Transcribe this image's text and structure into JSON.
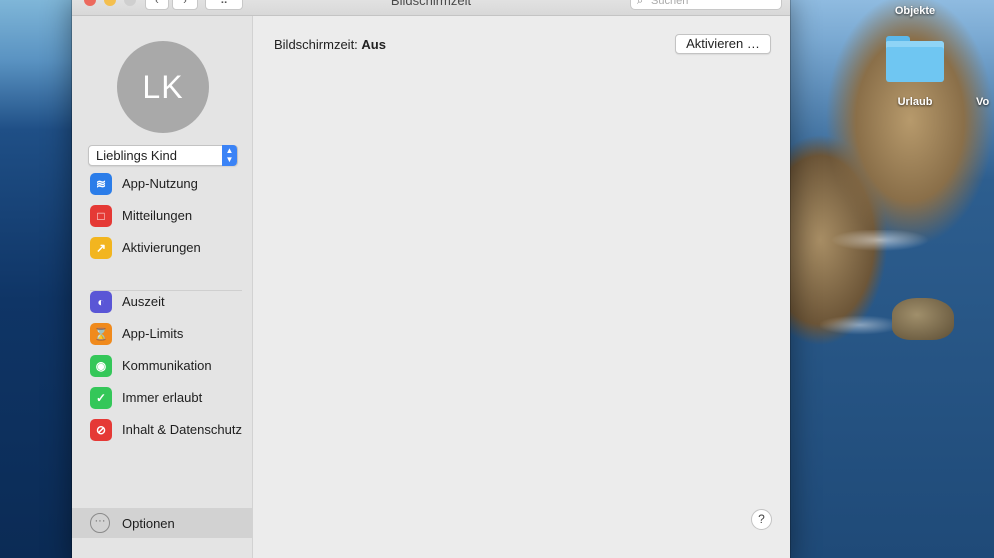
{
  "window": {
    "title": "Bildschirmzeit",
    "nav_back": "‹",
    "nav_forward": "›",
    "grid_button": "⠿",
    "search_placeholder": "Suchen"
  },
  "user": {
    "initials": "LK",
    "name": "Lieblings Kind"
  },
  "sidebar": {
    "items": [
      {
        "label": "App-Nutzung",
        "icon": "layers-icon",
        "color": "#2b7de9",
        "glyph": "≋"
      },
      {
        "label": "Mitteilungen",
        "icon": "notification-icon",
        "color": "#e53935",
        "glyph": "□"
      },
      {
        "label": "Aktivierungen",
        "icon": "pickups-icon",
        "color": "#f2b51f",
        "glyph": "↗"
      },
      {
        "label": "Auszeit",
        "icon": "downtime-icon",
        "color": "#5a56d6",
        "glyph": "◐"
      },
      {
        "label": "App-Limits",
        "icon": "hourglass-icon",
        "color": "#f08a1c",
        "glyph": "⌛"
      },
      {
        "label": "Kommunikation",
        "icon": "contact-icon",
        "color": "#34c759",
        "glyph": "◉"
      },
      {
        "label": "Immer erlaubt",
        "icon": "checkmark-badge-icon",
        "color": "#34c759",
        "glyph": "✓"
      },
      {
        "label": "Inhalt & Datenschutz",
        "icon": "restriction-icon",
        "color": "#e53935",
        "glyph": "⊘"
      }
    ],
    "options_label": "Optionen"
  },
  "main": {
    "status_label": "Bildschirmzeit:",
    "status_value": "Aus",
    "activate_button": "Aktivieren …",
    "help": "?"
  },
  "desktop": {
    "folder_label": "Urlaub",
    "top_label": "Objekte",
    "cut_label": "Vo"
  }
}
